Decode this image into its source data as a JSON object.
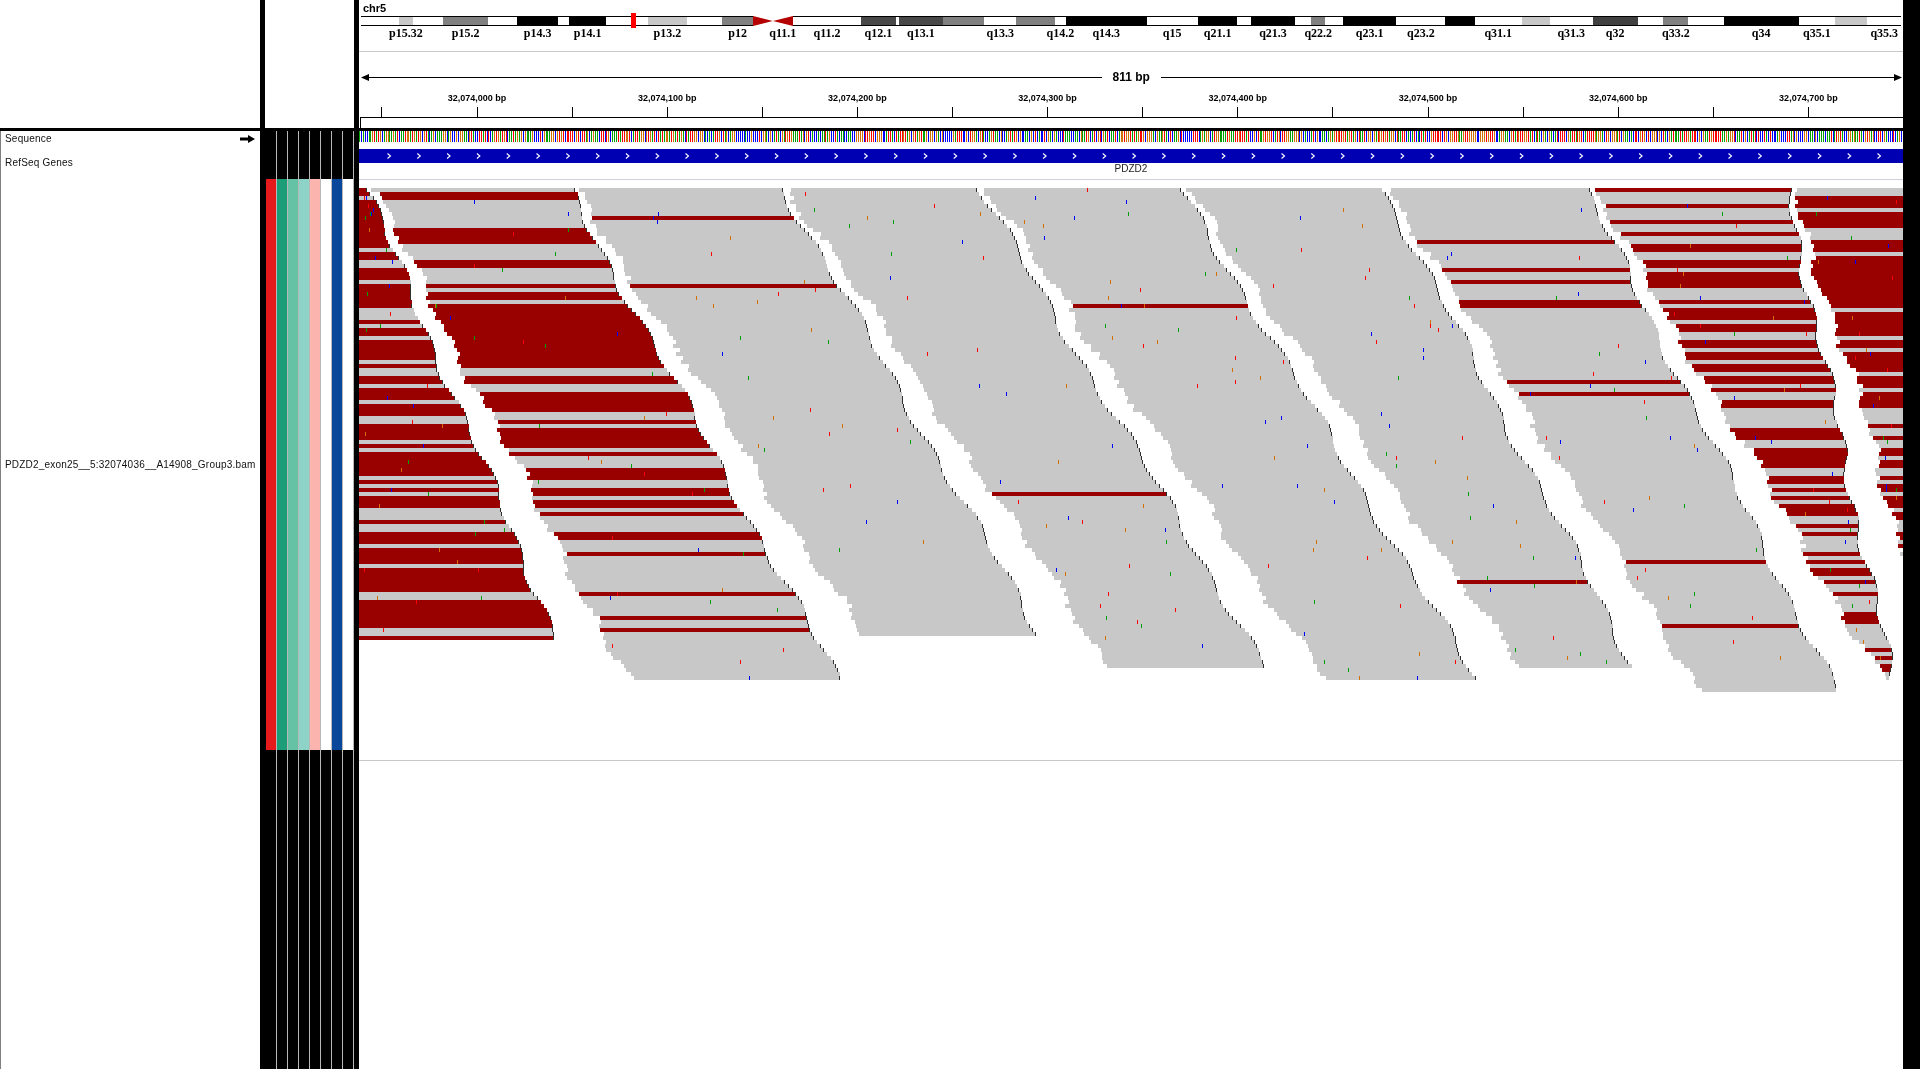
{
  "header": {
    "chromosome": "chr5",
    "ideogram": {
      "bands": [
        {
          "kind": "band",
          "color": "#ffffff"
        },
        {
          "kind": "band",
          "color": "#c8c8c8",
          "label": "p15.32"
        },
        {
          "kind": "band",
          "color": "#ffffff"
        },
        {
          "kind": "band",
          "color": "#808080",
          "label": "p15.2"
        },
        {
          "kind": "band",
          "color": "#ffffff"
        },
        {
          "kind": "band",
          "color": "#000000",
          "label": "p14.3"
        },
        {
          "kind": "band",
          "color": "#ffffff"
        },
        {
          "kind": "band",
          "color": "#000000",
          "label": "p14.1"
        },
        {
          "kind": "band",
          "color": "#ffffff"
        },
        {
          "kind": "band",
          "color": "#c8c8c8",
          "label": "p13.2"
        },
        {
          "kind": "band",
          "color": "#ffffff"
        },
        {
          "kind": "band",
          "color": "#808080",
          "label": "p12"
        },
        {
          "kind": "pcen",
          "color": "#b40000"
        },
        {
          "kind": "qcen",
          "color": "#b40000",
          "label": "q11.1"
        },
        {
          "kind": "band",
          "color": "#ffffff",
          "label": "q11.2"
        },
        {
          "kind": "band",
          "color": "#484848",
          "label": "q12.1"
        },
        {
          "kind": "band",
          "color": "#ffffff"
        },
        {
          "kind": "band",
          "color": "#484848",
          "label": "q13.1"
        },
        {
          "kind": "band",
          "color": "#808080"
        },
        {
          "kind": "band",
          "color": "#ffffff",
          "label": "q13.3"
        },
        {
          "kind": "band",
          "color": "#808080"
        },
        {
          "kind": "band",
          "color": "#ffffff",
          "label": "q14.2"
        },
        {
          "kind": "band",
          "color": "#000000",
          "label": "q14.3"
        },
        {
          "kind": "band",
          "color": "#ffffff",
          "label": "q15"
        },
        {
          "kind": "band",
          "color": "#000000",
          "label": "q21.1"
        },
        {
          "kind": "band",
          "color": "#ffffff"
        },
        {
          "kind": "band",
          "color": "#000000",
          "label": "q21.3"
        },
        {
          "kind": "band",
          "color": "#ffffff"
        },
        {
          "kind": "band",
          "color": "#808080",
          "label": "q22.2"
        },
        {
          "kind": "band",
          "color": "#ffffff"
        },
        {
          "kind": "band",
          "color": "#000000",
          "label": "q23.1"
        },
        {
          "kind": "band",
          "color": "#ffffff",
          "label": "q23.2"
        },
        {
          "kind": "band",
          "color": "#000000"
        },
        {
          "kind": "band",
          "color": "#ffffff",
          "label": "q31.1"
        },
        {
          "kind": "band",
          "color": "#c8c8c8"
        },
        {
          "kind": "band",
          "color": "#ffffff",
          "label": "q31.3"
        },
        {
          "kind": "band",
          "color": "#404040",
          "label": "q32"
        },
        {
          "kind": "band",
          "color": "#ffffff"
        },
        {
          "kind": "band",
          "color": "#808080",
          "label": "q33.2"
        },
        {
          "kind": "band",
          "color": "#ffffff"
        },
        {
          "kind": "band",
          "color": "#000000",
          "label": "q34"
        },
        {
          "kind": "band",
          "color": "#ffffff",
          "label": "q35.1"
        },
        {
          "kind": "band",
          "color": "#c8c8c8"
        },
        {
          "kind": "band",
          "color": "#ffffff",
          "label": "q35.3"
        }
      ]
    },
    "ruler": {
      "span": "811 bp",
      "ticks": [
        "32,074,000 bp",
        "32,074,100 bp",
        "32,074,200 bp",
        "32,074,300 bp",
        "32,074,400 bp",
        "32,074,500 bp",
        "32,074,600 bp",
        "32,074,700 bp"
      ]
    }
  },
  "tracks": [
    {
      "kind": "sequence",
      "name": "Sequence"
    },
    {
      "kind": "genes",
      "name": "RefSeq Genes",
      "feature": "PDZD2"
    },
    {
      "kind": "alignment",
      "name": "PDZD2_exon25__5:32074036__A14908_Group3.bam",
      "attributes": [
        {
          "color": "#e41a1c"
        },
        {
          "color": "#1b9e77"
        },
        {
          "color": "#66c2a5"
        },
        {
          "color": "#8dd3c7"
        },
        {
          "color": "#fbb4ae"
        },
        {
          "color": "#ffffff"
        },
        {
          "color": "#08479a"
        },
        {
          "color": "#ffffff"
        }
      ]
    }
  ]
}
